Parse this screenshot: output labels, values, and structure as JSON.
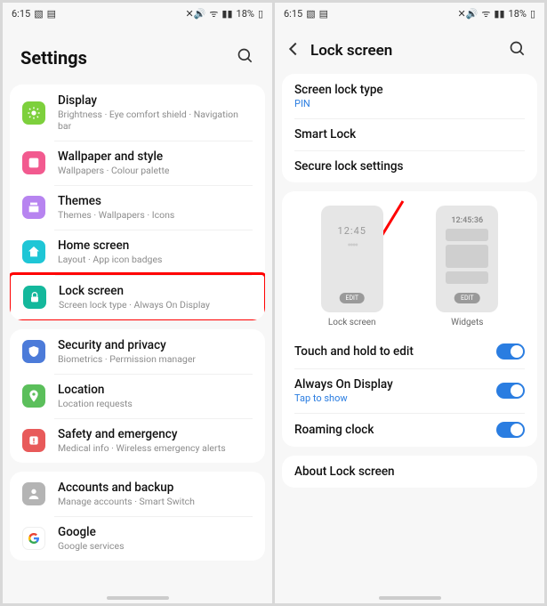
{
  "status": {
    "time": "6:15",
    "battery": "18%"
  },
  "left": {
    "title": "Settings",
    "items": [
      {
        "name": "display",
        "title": "Display",
        "sub": "Brightness  ·  Eye comfort shield  ·  Navigation bar",
        "color": "#7dd03c",
        "icon": "sun"
      },
      {
        "name": "wallpaper",
        "title": "Wallpaper and style",
        "sub": "Wallpapers  ·  Colour palette",
        "color": "#f25a8f",
        "icon": "palette"
      },
      {
        "name": "themes",
        "title": "Themes",
        "sub": "Themes  ·  Wallpapers  ·  Icons",
        "color": "#b784f0",
        "icon": "theme"
      },
      {
        "name": "home",
        "title": "Home screen",
        "sub": "Layout  ·  App icon badges",
        "color": "#1fc6d6",
        "icon": "home"
      },
      {
        "name": "lock",
        "title": "Lock screen",
        "sub": "Screen lock type  ·  Always On Display",
        "color": "#14b89c",
        "icon": "lock",
        "highlight": true
      },
      {
        "name": "security",
        "title": "Security and privacy",
        "sub": "Biometrics  ·  Permission manager",
        "color": "#4c7bd9",
        "icon": "shield"
      },
      {
        "name": "location",
        "title": "Location",
        "sub": "Location requests",
        "color": "#5bbf5b",
        "icon": "pin"
      },
      {
        "name": "safety",
        "title": "Safety and emergency",
        "sub": "Medical info  ·  Wireless emergency alerts",
        "color": "#e85a5a",
        "icon": "alert"
      },
      {
        "name": "accounts",
        "title": "Accounts and backup",
        "sub": "Manage accounts  ·  Smart Switch",
        "color": "#b4b4b4",
        "icon": "user"
      },
      {
        "name": "google",
        "title": "Google",
        "sub": "Google services",
        "color": "#fff",
        "icon": "google"
      }
    ]
  },
  "right": {
    "title": "Lock screen",
    "section1": {
      "lockType": {
        "title": "Screen lock type",
        "value": "PIN"
      },
      "smart": {
        "title": "Smart Lock"
      },
      "secure": {
        "title": "Secure lock settings"
      }
    },
    "preview": {
      "lockTime": "12:45",
      "widgetTime": "12:45:36",
      "edit": "EDIT",
      "lockLabel": "Lock screen",
      "widgetLabel": "Widgets"
    },
    "toggles": {
      "touch": {
        "title": "Touch and hold to edit"
      },
      "aod": {
        "title": "Always On Display",
        "value": "Tap to show"
      },
      "roaming": {
        "title": "Roaming clock"
      }
    },
    "about": {
      "title": "About Lock screen"
    }
  }
}
